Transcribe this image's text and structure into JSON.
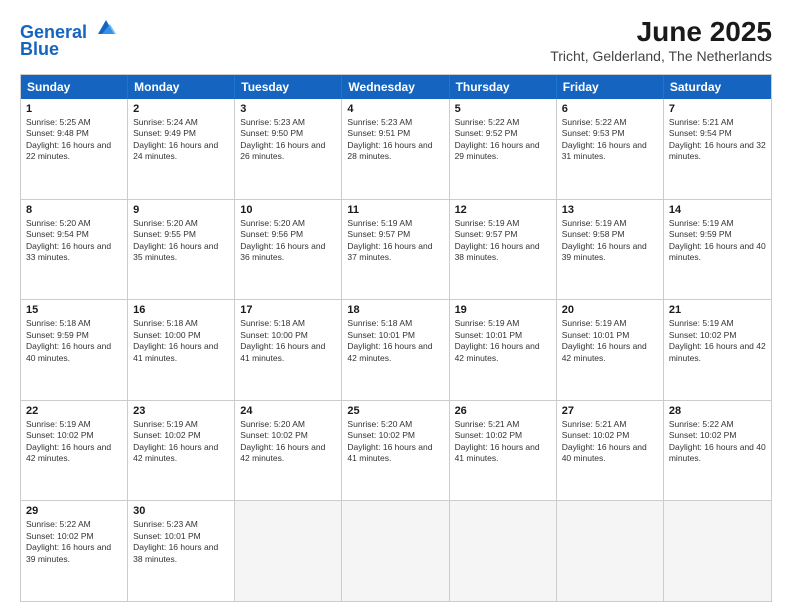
{
  "header": {
    "logo_line1": "General",
    "logo_line2": "Blue",
    "month_title": "June 2025",
    "location": "Tricht, Gelderland, The Netherlands"
  },
  "weekdays": [
    "Sunday",
    "Monday",
    "Tuesday",
    "Wednesday",
    "Thursday",
    "Friday",
    "Saturday"
  ],
  "weeks": [
    [
      {
        "day": "1",
        "sunrise": "Sunrise: 5:25 AM",
        "sunset": "Sunset: 9:48 PM",
        "daylight": "Daylight: 16 hours and 22 minutes."
      },
      {
        "day": "2",
        "sunrise": "Sunrise: 5:24 AM",
        "sunset": "Sunset: 9:49 PM",
        "daylight": "Daylight: 16 hours and 24 minutes."
      },
      {
        "day": "3",
        "sunrise": "Sunrise: 5:23 AM",
        "sunset": "Sunset: 9:50 PM",
        "daylight": "Daylight: 16 hours and 26 minutes."
      },
      {
        "day": "4",
        "sunrise": "Sunrise: 5:23 AM",
        "sunset": "Sunset: 9:51 PM",
        "daylight": "Daylight: 16 hours and 28 minutes."
      },
      {
        "day": "5",
        "sunrise": "Sunrise: 5:22 AM",
        "sunset": "Sunset: 9:52 PM",
        "daylight": "Daylight: 16 hours and 29 minutes."
      },
      {
        "day": "6",
        "sunrise": "Sunrise: 5:22 AM",
        "sunset": "Sunset: 9:53 PM",
        "daylight": "Daylight: 16 hours and 31 minutes."
      },
      {
        "day": "7",
        "sunrise": "Sunrise: 5:21 AM",
        "sunset": "Sunset: 9:54 PM",
        "daylight": "Daylight: 16 hours and 32 minutes."
      }
    ],
    [
      {
        "day": "8",
        "sunrise": "Sunrise: 5:20 AM",
        "sunset": "Sunset: 9:54 PM",
        "daylight": "Daylight: 16 hours and 33 minutes."
      },
      {
        "day": "9",
        "sunrise": "Sunrise: 5:20 AM",
        "sunset": "Sunset: 9:55 PM",
        "daylight": "Daylight: 16 hours and 35 minutes."
      },
      {
        "day": "10",
        "sunrise": "Sunrise: 5:20 AM",
        "sunset": "Sunset: 9:56 PM",
        "daylight": "Daylight: 16 hours and 36 minutes."
      },
      {
        "day": "11",
        "sunrise": "Sunrise: 5:19 AM",
        "sunset": "Sunset: 9:57 PM",
        "daylight": "Daylight: 16 hours and 37 minutes."
      },
      {
        "day": "12",
        "sunrise": "Sunrise: 5:19 AM",
        "sunset": "Sunset: 9:57 PM",
        "daylight": "Daylight: 16 hours and 38 minutes."
      },
      {
        "day": "13",
        "sunrise": "Sunrise: 5:19 AM",
        "sunset": "Sunset: 9:58 PM",
        "daylight": "Daylight: 16 hours and 39 minutes."
      },
      {
        "day": "14",
        "sunrise": "Sunrise: 5:19 AM",
        "sunset": "Sunset: 9:59 PM",
        "daylight": "Daylight: 16 hours and 40 minutes."
      }
    ],
    [
      {
        "day": "15",
        "sunrise": "Sunrise: 5:18 AM",
        "sunset": "Sunset: 9:59 PM",
        "daylight": "Daylight: 16 hours and 40 minutes."
      },
      {
        "day": "16",
        "sunrise": "Sunrise: 5:18 AM",
        "sunset": "Sunset: 10:00 PM",
        "daylight": "Daylight: 16 hours and 41 minutes."
      },
      {
        "day": "17",
        "sunrise": "Sunrise: 5:18 AM",
        "sunset": "Sunset: 10:00 PM",
        "daylight": "Daylight: 16 hours and 41 minutes."
      },
      {
        "day": "18",
        "sunrise": "Sunrise: 5:18 AM",
        "sunset": "Sunset: 10:01 PM",
        "daylight": "Daylight: 16 hours and 42 minutes."
      },
      {
        "day": "19",
        "sunrise": "Sunrise: 5:19 AM",
        "sunset": "Sunset: 10:01 PM",
        "daylight": "Daylight: 16 hours and 42 minutes."
      },
      {
        "day": "20",
        "sunrise": "Sunrise: 5:19 AM",
        "sunset": "Sunset: 10:01 PM",
        "daylight": "Daylight: 16 hours and 42 minutes."
      },
      {
        "day": "21",
        "sunrise": "Sunrise: 5:19 AM",
        "sunset": "Sunset: 10:02 PM",
        "daylight": "Daylight: 16 hours and 42 minutes."
      }
    ],
    [
      {
        "day": "22",
        "sunrise": "Sunrise: 5:19 AM",
        "sunset": "Sunset: 10:02 PM",
        "daylight": "Daylight: 16 hours and 42 minutes."
      },
      {
        "day": "23",
        "sunrise": "Sunrise: 5:19 AM",
        "sunset": "Sunset: 10:02 PM",
        "daylight": "Daylight: 16 hours and 42 minutes."
      },
      {
        "day": "24",
        "sunrise": "Sunrise: 5:20 AM",
        "sunset": "Sunset: 10:02 PM",
        "daylight": "Daylight: 16 hours and 42 minutes."
      },
      {
        "day": "25",
        "sunrise": "Sunrise: 5:20 AM",
        "sunset": "Sunset: 10:02 PM",
        "daylight": "Daylight: 16 hours and 41 minutes."
      },
      {
        "day": "26",
        "sunrise": "Sunrise: 5:21 AM",
        "sunset": "Sunset: 10:02 PM",
        "daylight": "Daylight: 16 hours and 41 minutes."
      },
      {
        "day": "27",
        "sunrise": "Sunrise: 5:21 AM",
        "sunset": "Sunset: 10:02 PM",
        "daylight": "Daylight: 16 hours and 40 minutes."
      },
      {
        "day": "28",
        "sunrise": "Sunrise: 5:22 AM",
        "sunset": "Sunset: 10:02 PM",
        "daylight": "Daylight: 16 hours and 40 minutes."
      }
    ],
    [
      {
        "day": "29",
        "sunrise": "Sunrise: 5:22 AM",
        "sunset": "Sunset: 10:02 PM",
        "daylight": "Daylight: 16 hours and 39 minutes."
      },
      {
        "day": "30",
        "sunrise": "Sunrise: 5:23 AM",
        "sunset": "Sunset: 10:01 PM",
        "daylight": "Daylight: 16 hours and 38 minutes."
      },
      {
        "day": "",
        "sunrise": "",
        "sunset": "",
        "daylight": ""
      },
      {
        "day": "",
        "sunrise": "",
        "sunset": "",
        "daylight": ""
      },
      {
        "day": "",
        "sunrise": "",
        "sunset": "",
        "daylight": ""
      },
      {
        "day": "",
        "sunrise": "",
        "sunset": "",
        "daylight": ""
      },
      {
        "day": "",
        "sunrise": "",
        "sunset": "",
        "daylight": ""
      }
    ]
  ]
}
